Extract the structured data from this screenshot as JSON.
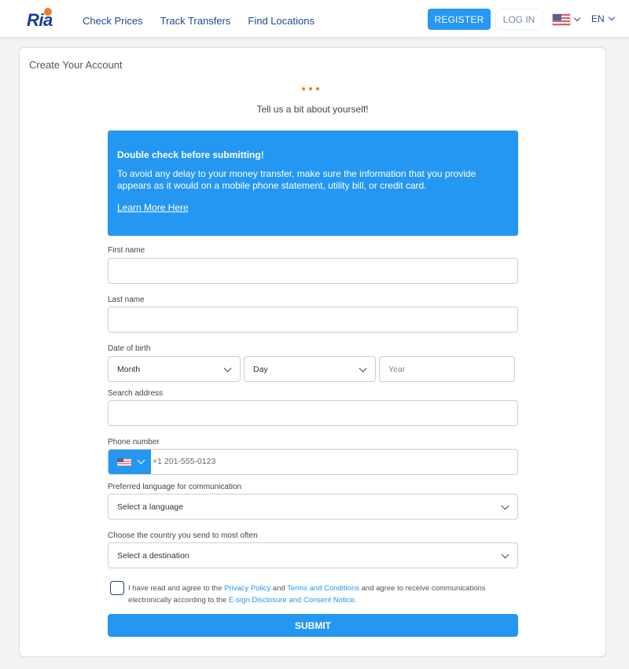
{
  "header": {
    "logo_text": "Ria",
    "nav": [
      "Check Prices",
      "Track Transfers",
      "Find Locations"
    ],
    "register_label": "REGISTER",
    "login_label": "LOG IN",
    "country_flag": "us-flag-icon",
    "language": "EN"
  },
  "card": {
    "title": "Create Your Account",
    "subtitle": "Tell us a bit about yourself!",
    "step_dots": 3
  },
  "info_box": {
    "heading": "Double check before submitting!",
    "body": "To avoid any delay to your money transfer, make sure the information that you provide appears as it would on a mobile phone statement, utility bill, or credit card.",
    "link": "Learn More Here",
    "color": "#2497f2"
  },
  "form": {
    "first_name": {
      "label": "First name",
      "value": ""
    },
    "last_name": {
      "label": "Last name",
      "value": ""
    },
    "dob": {
      "label": "Date of birth",
      "month": "Month",
      "day": "Day",
      "year_placeholder": "Year"
    },
    "address": {
      "label": "Search address",
      "value": ""
    },
    "phone": {
      "label": "Phone number",
      "placeholder": "+1 201-555-0123",
      "country": "US"
    },
    "language": {
      "label": "Preferred language for communication",
      "value": "Select a language"
    },
    "destination": {
      "label": "Choose the country you send to most often",
      "value": "Select a destination"
    }
  },
  "consent": {
    "checked": false,
    "text_1": "I have read and agree to the ",
    "privacy_link": "Privacy Policy",
    "text_2": " and ",
    "terms_link": "Terms and Conditions",
    "text_3": " and agree to receive communications electronically according to the ",
    "esign_link": "E-sign Disclosure and Consent Notice",
    "text_4": "."
  },
  "submit_label": "SUBMIT"
}
